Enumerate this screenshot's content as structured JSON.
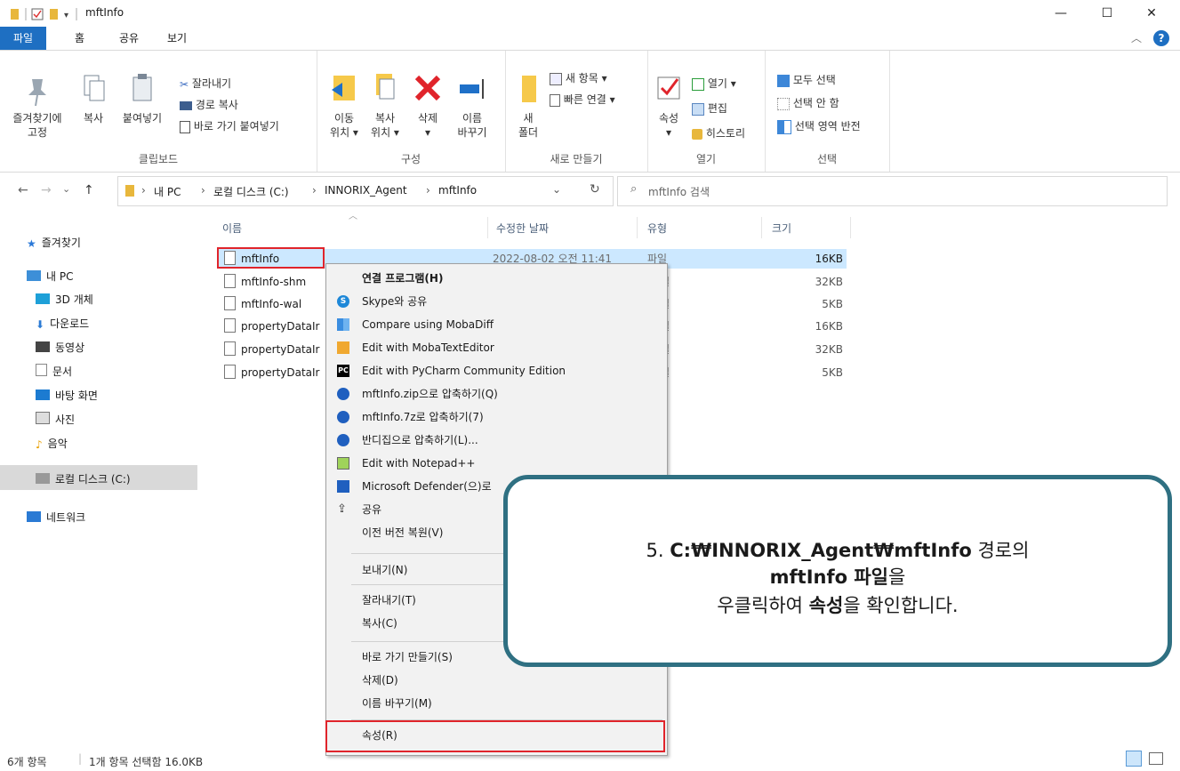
{
  "window": {
    "title": "mftInfo",
    "minimize_glyph": "—",
    "maximize_glyph": "☐",
    "close_glyph": "✕"
  },
  "ribbon_tabs": [
    "파일",
    "홈",
    "공유",
    "보기"
  ],
  "ribbon": {
    "clipboard": {
      "pin_label_1": "즐겨찾기에",
      "pin_label_2": "고정",
      "copy_label": "복사",
      "paste_label": "붙여넣기",
      "cut_label": "잘라내기",
      "copy_path_label": "경로 복사",
      "paste_shortcut_label": "바로 가기 붙여넣기",
      "group_label": "클립보드"
    },
    "organize": {
      "move_label_1": "이동",
      "move_label_2": "위치 ▾",
      "copyto_label_1": "복사",
      "copyto_label_2": "위치 ▾",
      "delete_label_1": "삭제",
      "delete_label_2": "▾",
      "rename_label_1": "이름",
      "rename_label_2": "바꾸기",
      "group_label": "구성"
    },
    "new": {
      "new_item_label": "새 항목 ▾",
      "easy_access_label": "빠른 연결 ▾",
      "new_folder_label_1": "새",
      "new_folder_label_2": "폴더",
      "group_label": "새로 만들기"
    },
    "open": {
      "properties_label_1": "속성",
      "properties_label_2": "▾",
      "open_label": "열기 ▾",
      "edit_label": "편집",
      "history_label": "히스토리",
      "group_label": "열기"
    },
    "select": {
      "select_all_label": "모두 선택",
      "select_none_label": "선택 안 함",
      "invert_label": "선택 영역 반전",
      "group_label": "선택"
    }
  },
  "address": {
    "back": "←",
    "forward": "→",
    "recent": "⌄",
    "up": "↑",
    "crumbs": [
      "내 PC",
      "로컬 디스크 (C:)",
      "INNORIX_Agent",
      "mftInfo"
    ],
    "separator": "›",
    "dropdown": "⌄",
    "refresh": "↻",
    "search_placeholder": "mftInfo 검색"
  },
  "nav_pane": [
    {
      "label": "즐겨찾기",
      "icon": "star-icon",
      "color": "#2b79d8"
    },
    {
      "label": "내 PC",
      "icon": "pc-icon",
      "color": "#3d8fd8"
    },
    {
      "label": "3D 개체",
      "icon": "cube-icon",
      "color": "#1ea0d8"
    },
    {
      "label": "다운로드",
      "icon": "download-icon",
      "color": "#2a7ad4"
    },
    {
      "label": "동영상",
      "icon": "video-icon",
      "color": "#444"
    },
    {
      "label": "문서",
      "icon": "document-icon",
      "color": "#888"
    },
    {
      "label": "바탕 화면",
      "icon": "desktop-icon",
      "color": "#1c7bd1"
    },
    {
      "label": "사진",
      "icon": "picture-icon",
      "color": "#777"
    },
    {
      "label": "음악",
      "icon": "music-icon",
      "color": "#e8a000"
    },
    {
      "label": "로컬 디스크 (C:)",
      "icon": "drive-icon",
      "color": "#777"
    },
    {
      "label": "네트워크",
      "icon": "network-icon",
      "color": "#2a7ad4"
    }
  ],
  "columns": {
    "name": "이름",
    "modified": "수정한 날짜",
    "type": "유형",
    "size": "크기"
  },
  "files": [
    {
      "name": "mftInfo",
      "modified": "2022-08-02 오전 11:41",
      "type": "파일",
      "size": "16KB"
    },
    {
      "name": "mftInfo-shm",
      "modified": "",
      "type": "일",
      "size": "32KB"
    },
    {
      "name": "mftInfo-wal",
      "modified": "",
      "type": "일",
      "size": "5KB"
    },
    {
      "name": "propertyDataIr",
      "modified": "",
      "type": "일",
      "size": "16KB"
    },
    {
      "name": "propertyDataIr",
      "modified": "",
      "type": "일",
      "size": "32KB"
    },
    {
      "name": "propertyDataIr",
      "modified": "",
      "type": "일",
      "size": "5KB"
    }
  ],
  "context_menu": [
    {
      "label": "연결 프로그램(H)",
      "icon": "",
      "bold": true
    },
    {
      "label": "Skype와 공유",
      "icon": "skype-icon"
    },
    {
      "label": "Compare using MobaDiff",
      "icon": "mobadiff-icon"
    },
    {
      "label": "Edit with MobaTextEditor",
      "icon": "mobatexteditor-icon"
    },
    {
      "label": "Edit with PyCharm Community Edition",
      "icon": "pycharm-icon"
    },
    {
      "label": "mftInfo.zip으로 압축하기(Q)",
      "icon": "bandizip-icon"
    },
    {
      "label": "mftInfo.7z로 압축하기(7)",
      "icon": "bandizip-icon"
    },
    {
      "label": "반디집으로 압축하기(L)...",
      "icon": "bandizip-icon"
    },
    {
      "label": "Edit with Notepad++",
      "icon": "notepadpp-icon"
    },
    {
      "label": "Microsoft Defender(으)로",
      "icon": "defender-icon"
    },
    {
      "label": "공유",
      "icon": "share-icon"
    },
    {
      "label": "이전 버전 복원(V)",
      "icon": ""
    },
    {
      "label": "보내기(N)",
      "icon": ""
    },
    {
      "label": "잘라내기(T)",
      "icon": ""
    },
    {
      "label": "복사(C)",
      "icon": ""
    },
    {
      "label": "바로 가기 만들기(S)",
      "icon": ""
    },
    {
      "label": "삭제(D)",
      "icon": ""
    },
    {
      "label": "이름 바꾸기(M)",
      "icon": ""
    },
    {
      "label": "속성(R)",
      "icon": ""
    }
  ],
  "callout": {
    "line1_prefix": "5. ",
    "line1_bold": "C:₩INNORIX_Agent₩mftInfo",
    "line1_suffix": " 경로의",
    "line2_bold": "mftInfo 파일",
    "line2_suffix": "을",
    "line3_prefix": "우클릭하여 ",
    "line3_bold": "속성",
    "line3_suffix": "을 확인합니다."
  },
  "status": {
    "count": "6개 항목",
    "selection": "1개 항목 선택함 16.0KB"
  },
  "colors": {
    "accent": "#1e6fc2",
    "highlight_red": "#e0242b",
    "callout_border": "#2f7082",
    "selection_bg": "#cce8ff"
  }
}
